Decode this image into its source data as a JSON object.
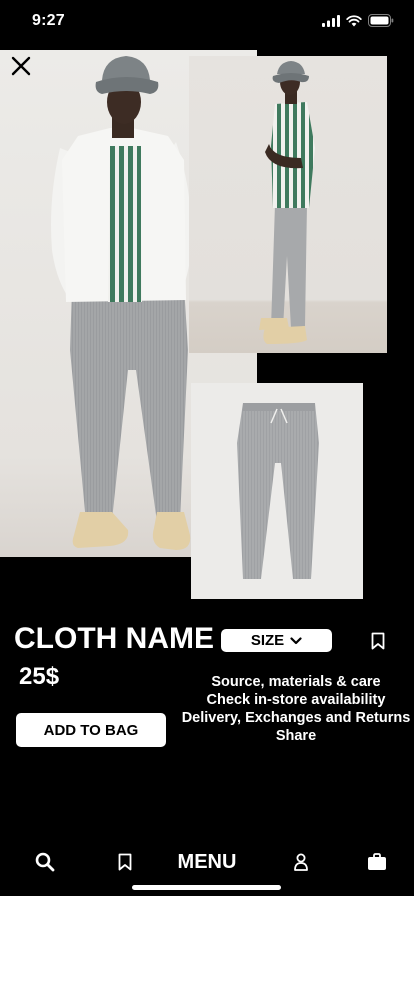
{
  "status_bar": {
    "time": "9:27",
    "icons": [
      "signal-icon",
      "wifi-icon",
      "battery-icon"
    ]
  },
  "product": {
    "name": "CLOTH NAME",
    "price": "25$",
    "size_label": "SIZE",
    "add_to_bag_label": "ADD TO BAG",
    "images": [
      "model-front-photo",
      "model-side-photo",
      "trousers-flat-photo"
    ]
  },
  "info_links": [
    "Source, materials & care",
    "Check in-store availability",
    "Delivery, Exchanges and Returns",
    "Share"
  ],
  "bottom_nav": {
    "menu_label": "MENU",
    "icons": [
      "search-icon",
      "bookmark-icon",
      "person-icon",
      "shopping-bag-icon"
    ]
  },
  "colors": {
    "background": "#000000",
    "button_bg": "#ffffff",
    "text": "#ffffff",
    "shirt_stripe": "#3f7a5e",
    "trousers": "#a7a9ab"
  }
}
